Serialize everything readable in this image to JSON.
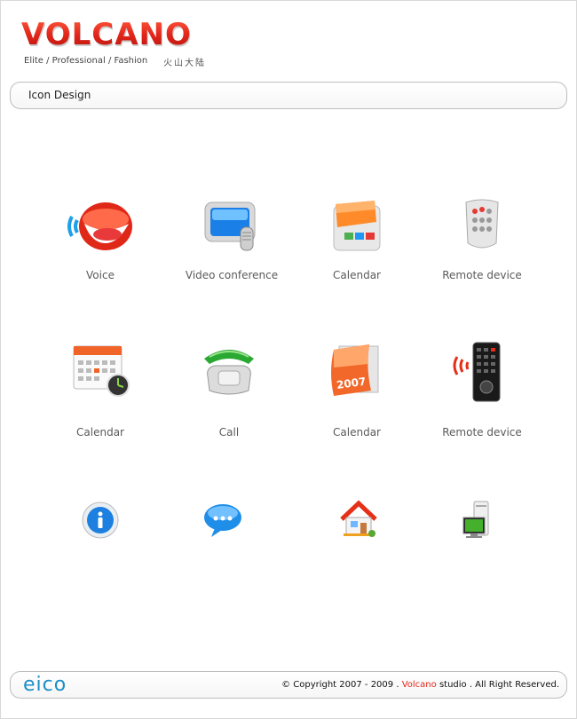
{
  "brand": {
    "logo_text": "VOLCANO",
    "tagline": "Elite / Professional / Fashion",
    "tagline_cn": "火山大陆",
    "accent_color": "#e3261b"
  },
  "header": {
    "title": "Icon Design"
  },
  "icons": [
    {
      "label": "Voice",
      "icon": "voice-icon"
    },
    {
      "label": "Video conference",
      "icon": "video-conference-icon"
    },
    {
      "label": "Calendar",
      "icon": "calendar-icon"
    },
    {
      "label": "Remote device",
      "icon": "remote-device-icon"
    },
    {
      "label": "Calendar",
      "icon": "calendar-clock-icon"
    },
    {
      "label": "Call",
      "icon": "phone-icon"
    },
    {
      "label": "Calendar",
      "icon": "calendar-2007-icon"
    },
    {
      "label": "Remote device",
      "icon": "remote-control-icon"
    },
    {
      "label": "",
      "icon": "info-icon"
    },
    {
      "label": "",
      "icon": "chat-bubble-icon"
    },
    {
      "label": "",
      "icon": "home-icon"
    },
    {
      "label": "",
      "icon": "computer-icon"
    }
  ],
  "footer": {
    "logo": "eico",
    "copyright_prefix": "© Copyright 2007 - 2009 .",
    "copyright_brand": "Volcano",
    "copyright_suffix": "studio . All Right Reserved."
  }
}
